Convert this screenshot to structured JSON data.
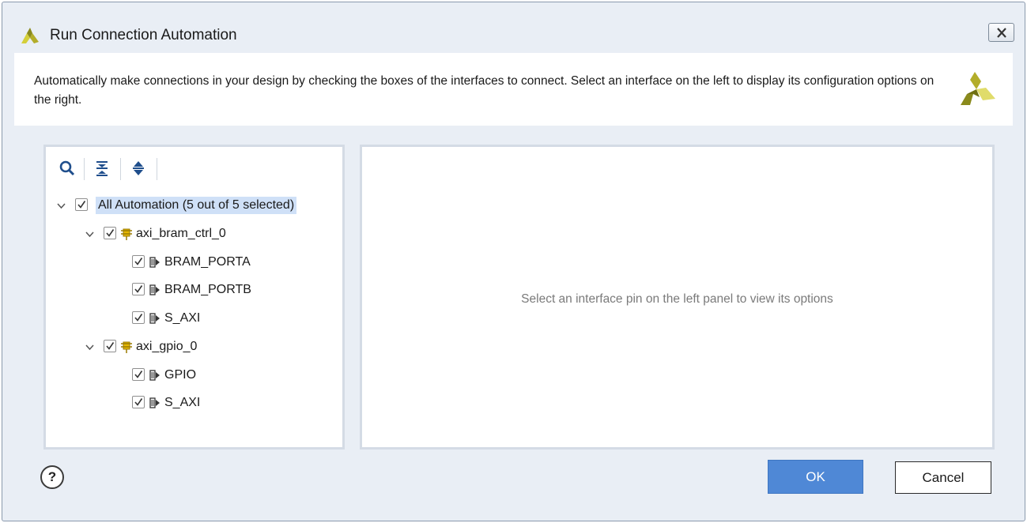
{
  "window": {
    "title": "Run Connection Automation",
    "close_icon": "close-icon"
  },
  "banner": {
    "description": "Automatically make connections in your design by checking the boxes of the interfaces to connect. Select an interface on the left to display its configuration options on the right."
  },
  "toolbar": {
    "icons": [
      "search-icon",
      "collapse-all-icon",
      "expand-all-icon"
    ]
  },
  "tree": {
    "root": {
      "label": "All Automation (5 out of 5 selected)",
      "checked": true,
      "expanded": true,
      "selected": true
    },
    "ip_blocks": [
      {
        "label": "axi_bram_ctrl_0",
        "checked": true,
        "expanded": true,
        "icon": "ip-block-icon",
        "interfaces": [
          {
            "label": "BRAM_PORTA",
            "checked": true,
            "icon": "interface-pin-icon"
          },
          {
            "label": "BRAM_PORTB",
            "checked": true,
            "icon": "interface-pin-icon"
          },
          {
            "label": "S_AXI",
            "checked": true,
            "icon": "interface-pin-icon"
          }
        ]
      },
      {
        "label": "axi_gpio_0",
        "checked": true,
        "expanded": true,
        "icon": "ip-block-icon",
        "interfaces": [
          {
            "label": "GPIO",
            "checked": true,
            "icon": "interface-pin-icon"
          },
          {
            "label": "S_AXI",
            "checked": true,
            "icon": "interface-pin-icon"
          }
        ]
      }
    ]
  },
  "options_panel": {
    "message": "Select an interface pin on the left panel to view its options"
  },
  "footer": {
    "help_label": "?",
    "ok_label": "OK",
    "cancel_label": "Cancel"
  },
  "colors": {
    "accent": "#4f88d6",
    "selection": "#cfe0f7",
    "ip_icon": "#e6b800",
    "logo_dark": "#8a8a1c",
    "logo_light": "#d4cf3a"
  }
}
